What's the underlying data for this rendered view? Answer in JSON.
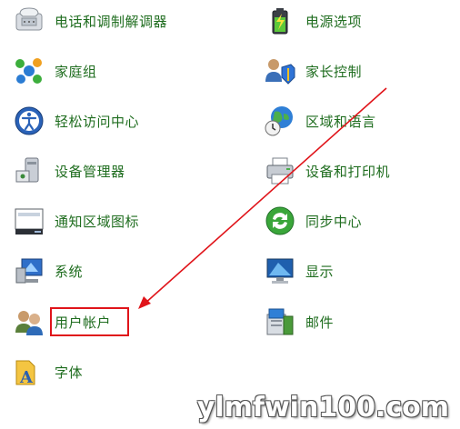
{
  "items": [
    {
      "label": "电话和调制解调器",
      "icon": "phone-modem-icon"
    },
    {
      "label": "电源选项",
      "icon": "battery-power-icon"
    },
    {
      "label": "家庭组",
      "icon": "homegroup-icon"
    },
    {
      "label": "家长控制",
      "icon": "parental-controls-icon"
    },
    {
      "label": "轻松访问中心",
      "icon": "ease-of-access-icon"
    },
    {
      "label": "区域和语言",
      "icon": "region-language-globe-icon"
    },
    {
      "label": "设备管理器",
      "icon": "device-manager-icon"
    },
    {
      "label": "设备和打印机",
      "icon": "printer-icon"
    },
    {
      "label": "通知区域图标",
      "icon": "notification-area-icon"
    },
    {
      "label": "同步中心",
      "icon": "sync-center-icon"
    },
    {
      "label": "系统",
      "icon": "system-icon"
    },
    {
      "label": "显示",
      "icon": "display-monitor-icon"
    },
    {
      "label": "用户帐户",
      "icon": "user-accounts-icon"
    },
    {
      "label": "邮件",
      "icon": "mail-icon"
    },
    {
      "label": "字体",
      "icon": "fonts-icon"
    }
  ],
  "annotation": {
    "highlight_color": "#e0141a"
  },
  "watermark": {
    "text": "ylmfwin100.com"
  }
}
